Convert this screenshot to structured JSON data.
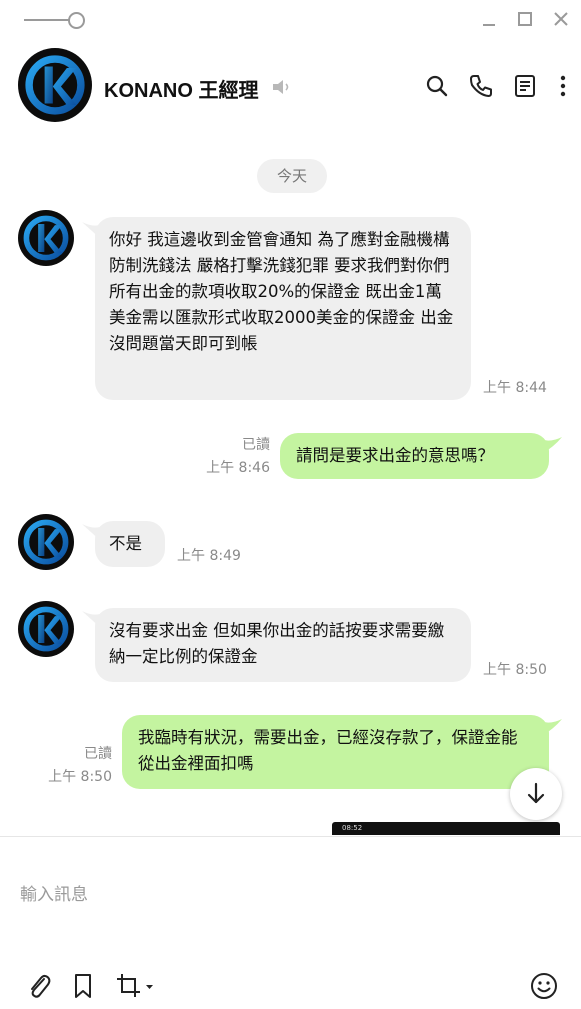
{
  "chat": {
    "title": "KONANO 王經理",
    "date_label": "今天"
  },
  "messages": [
    {
      "direction": "in",
      "text": "你好 我這邊收到金管會通知 為了應對金融機構防制洗錢法 嚴格打擊洗錢犯罪 要求我們對你們所有出金的款項收取20%的保證金 既出金1萬美金需以匯款形式收取2000美金的保證金 出金沒問題當天即可到帳",
      "time": "上午 8:44"
    },
    {
      "direction": "out",
      "text": "請問是要求出金的意思嗎？",
      "read": "已讀",
      "time": "上午 8:46"
    },
    {
      "direction": "in",
      "text": "不是",
      "time": "上午 8:49"
    },
    {
      "direction": "in",
      "text": "沒有要求出金 但如果你出金的話按要求需要繳納一定比例的保證金",
      "time": "上午 8:50"
    },
    {
      "direction": "out",
      "text": "我臨時有狀況，需要出金，已經沒存款了，保證金能從出金裡面扣嗎",
      "read": "已讀",
      "time": "上午 8:50"
    }
  ],
  "preview_strip": "08:52",
  "composer": {
    "placeholder": "輸入訊息"
  },
  "icons": {
    "search": "search-icon",
    "call": "phone-icon",
    "notes": "notes-icon",
    "more": "more-vertical-icon",
    "mute": "speaker-muted-icon",
    "attach": "paperclip-icon",
    "bookmark": "bookmark-icon",
    "crop": "crop-icon",
    "emoji": "emoji-icon",
    "scroll": "arrow-down-icon"
  },
  "colors": {
    "outgoing_bubble": "#c4f4a0",
    "incoming_bubble": "#efefef",
    "brand_blue": "#1f7fd8"
  }
}
